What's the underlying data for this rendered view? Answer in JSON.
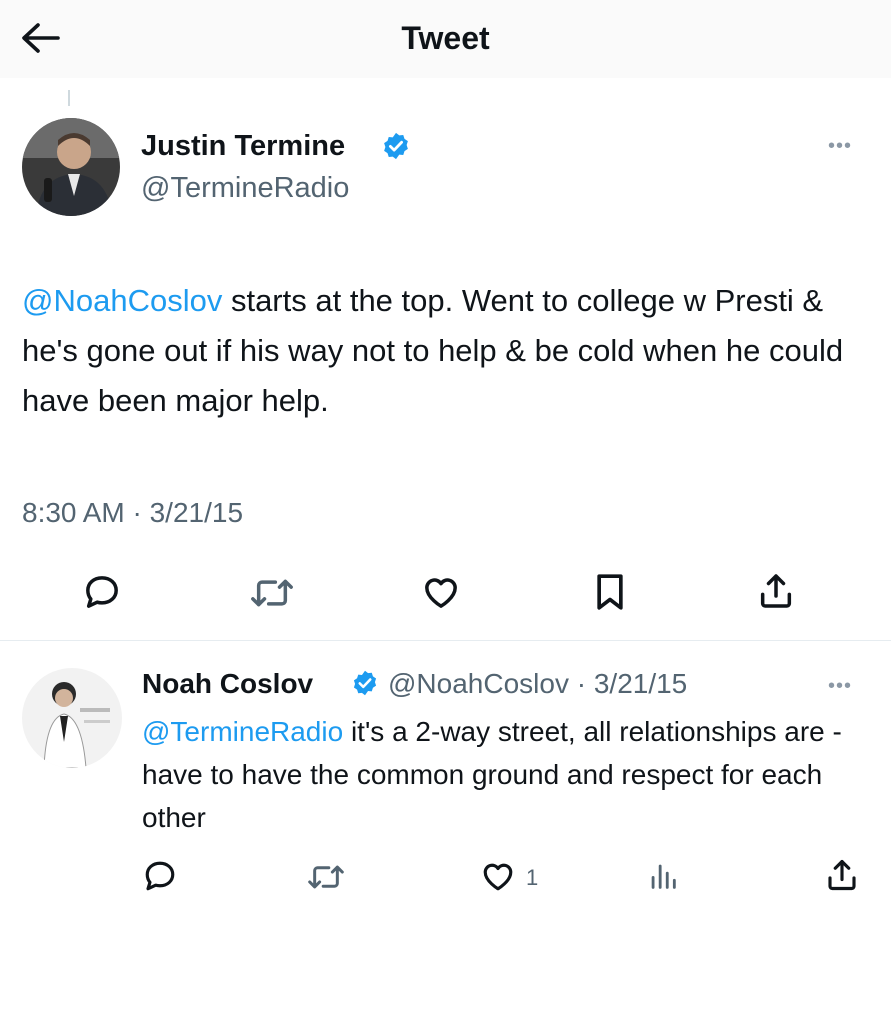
{
  "header": {
    "title": "Tweet",
    "back_icon": "arrow-left-icon"
  },
  "tweet": {
    "author_name": "Justin Termine",
    "author_handle": "@TermineRadio",
    "verified_color": "#1d9bf0",
    "text_mention": "@NoahCoslov",
    "text_body": " starts at the top. Went to college w Presti & he's gone out if his way not to help & be cold when he could have been major help.",
    "timestamp": "8:30 AM · 3/21/15",
    "actions": [
      "reply-icon",
      "retweet-icon",
      "like-icon",
      "bookmark-icon",
      "share-icon"
    ]
  },
  "reply": {
    "author_name": "Noah Coslov",
    "author_handle": "@NoahCoslov",
    "date": "· 3/21/15",
    "text_mention": "@TermineRadio",
    "text_body": " it's a 2-way street, all relationships are - have to have the common ground and respect for each other",
    "like_count": "1",
    "actions": [
      "reply-icon",
      "retweet-icon",
      "like-icon",
      "views-icon",
      "share-icon"
    ]
  },
  "colors": {
    "accent": "#1d9bf0",
    "text": "#0f1419",
    "muted": "#536471"
  }
}
